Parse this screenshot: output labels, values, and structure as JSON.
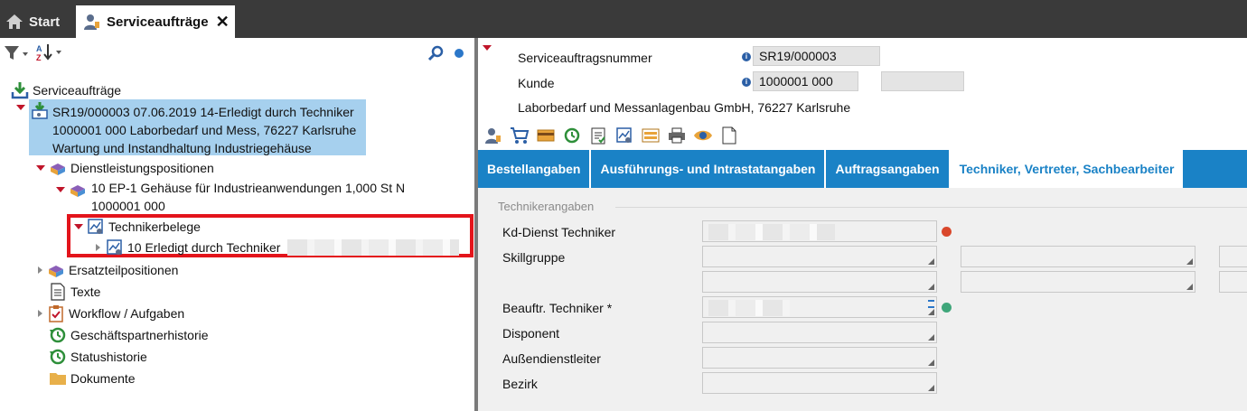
{
  "tabs": {
    "start_label": "Start",
    "active_label": "Serviceaufträge",
    "close_label": "✕"
  },
  "tree": {
    "root_label": "Serviceaufträge",
    "order": {
      "line1": "SR19/000003 07.06.2019 14-Erledigt durch Techniker",
      "line2": "1000001 000 Laborbedarf und Mess, 76227 Karlsruhe",
      "line3": "Wartung und Instandhaltung Industriegehäuse"
    },
    "services_label": "Dienstleistungspositionen",
    "position": {
      "line1": "10 EP-1 Gehäuse für Industrieanwendungen 1,000 St N",
      "line2": "1000001 000"
    },
    "tech_docs_label": "Technikerbelege",
    "tech_doc_item": "10  Erledigt durch Techniker",
    "spare_parts_label": "Ersatzteilpositionen",
    "texts_label": "Texte",
    "workflow_label": "Workflow / Aufgaben",
    "partner_history_label": "Geschäftspartnerhistorie",
    "status_history_label": "Statushistorie",
    "documents_label": "Dokumente"
  },
  "header": {
    "order_number_label": "Serviceauftragsnummer",
    "order_number_value": "SR19/000003",
    "customer_label": "Kunde",
    "customer_value": "1000001 000",
    "customer_name": "Laborbedarf und Messanlagenbau GmbH, 76227 Karlsruhe"
  },
  "subtabs": [
    "Bestellangaben",
    "Ausführungs- und Intrastatangaben",
    "Auftragsangaben",
    "Techniker, Vertreter, Sachbearbeiter"
  ],
  "form": {
    "section_label": "Technikerangaben",
    "kd_dienst_label": "Kd-Dienst Techniker",
    "skillgruppe_label": "Skillgruppe",
    "beauftr_label": "Beauftr. Techniker *",
    "disponent_label": "Disponent",
    "aussendienst_label": "Außendienstleiter",
    "bezirk_label": "Bezirk"
  },
  "colors": {
    "accent": "#1a82c6",
    "selection": "#a6d0ee",
    "highlight_box": "#e3141b",
    "status_red": "#d9472b",
    "status_green": "#3fa67a"
  },
  "icons": {
    "toolbar_left": [
      "filter-icon",
      "sort-az-icon",
      "search-icon",
      "dot-icon"
    ],
    "toolbar_right": [
      "technician-icon",
      "cart-icon",
      "card-icon",
      "history-icon",
      "checklist-icon",
      "image-doc-icon",
      "form-icon",
      "print-icon",
      "preview-icon",
      "blank-doc-icon"
    ]
  }
}
